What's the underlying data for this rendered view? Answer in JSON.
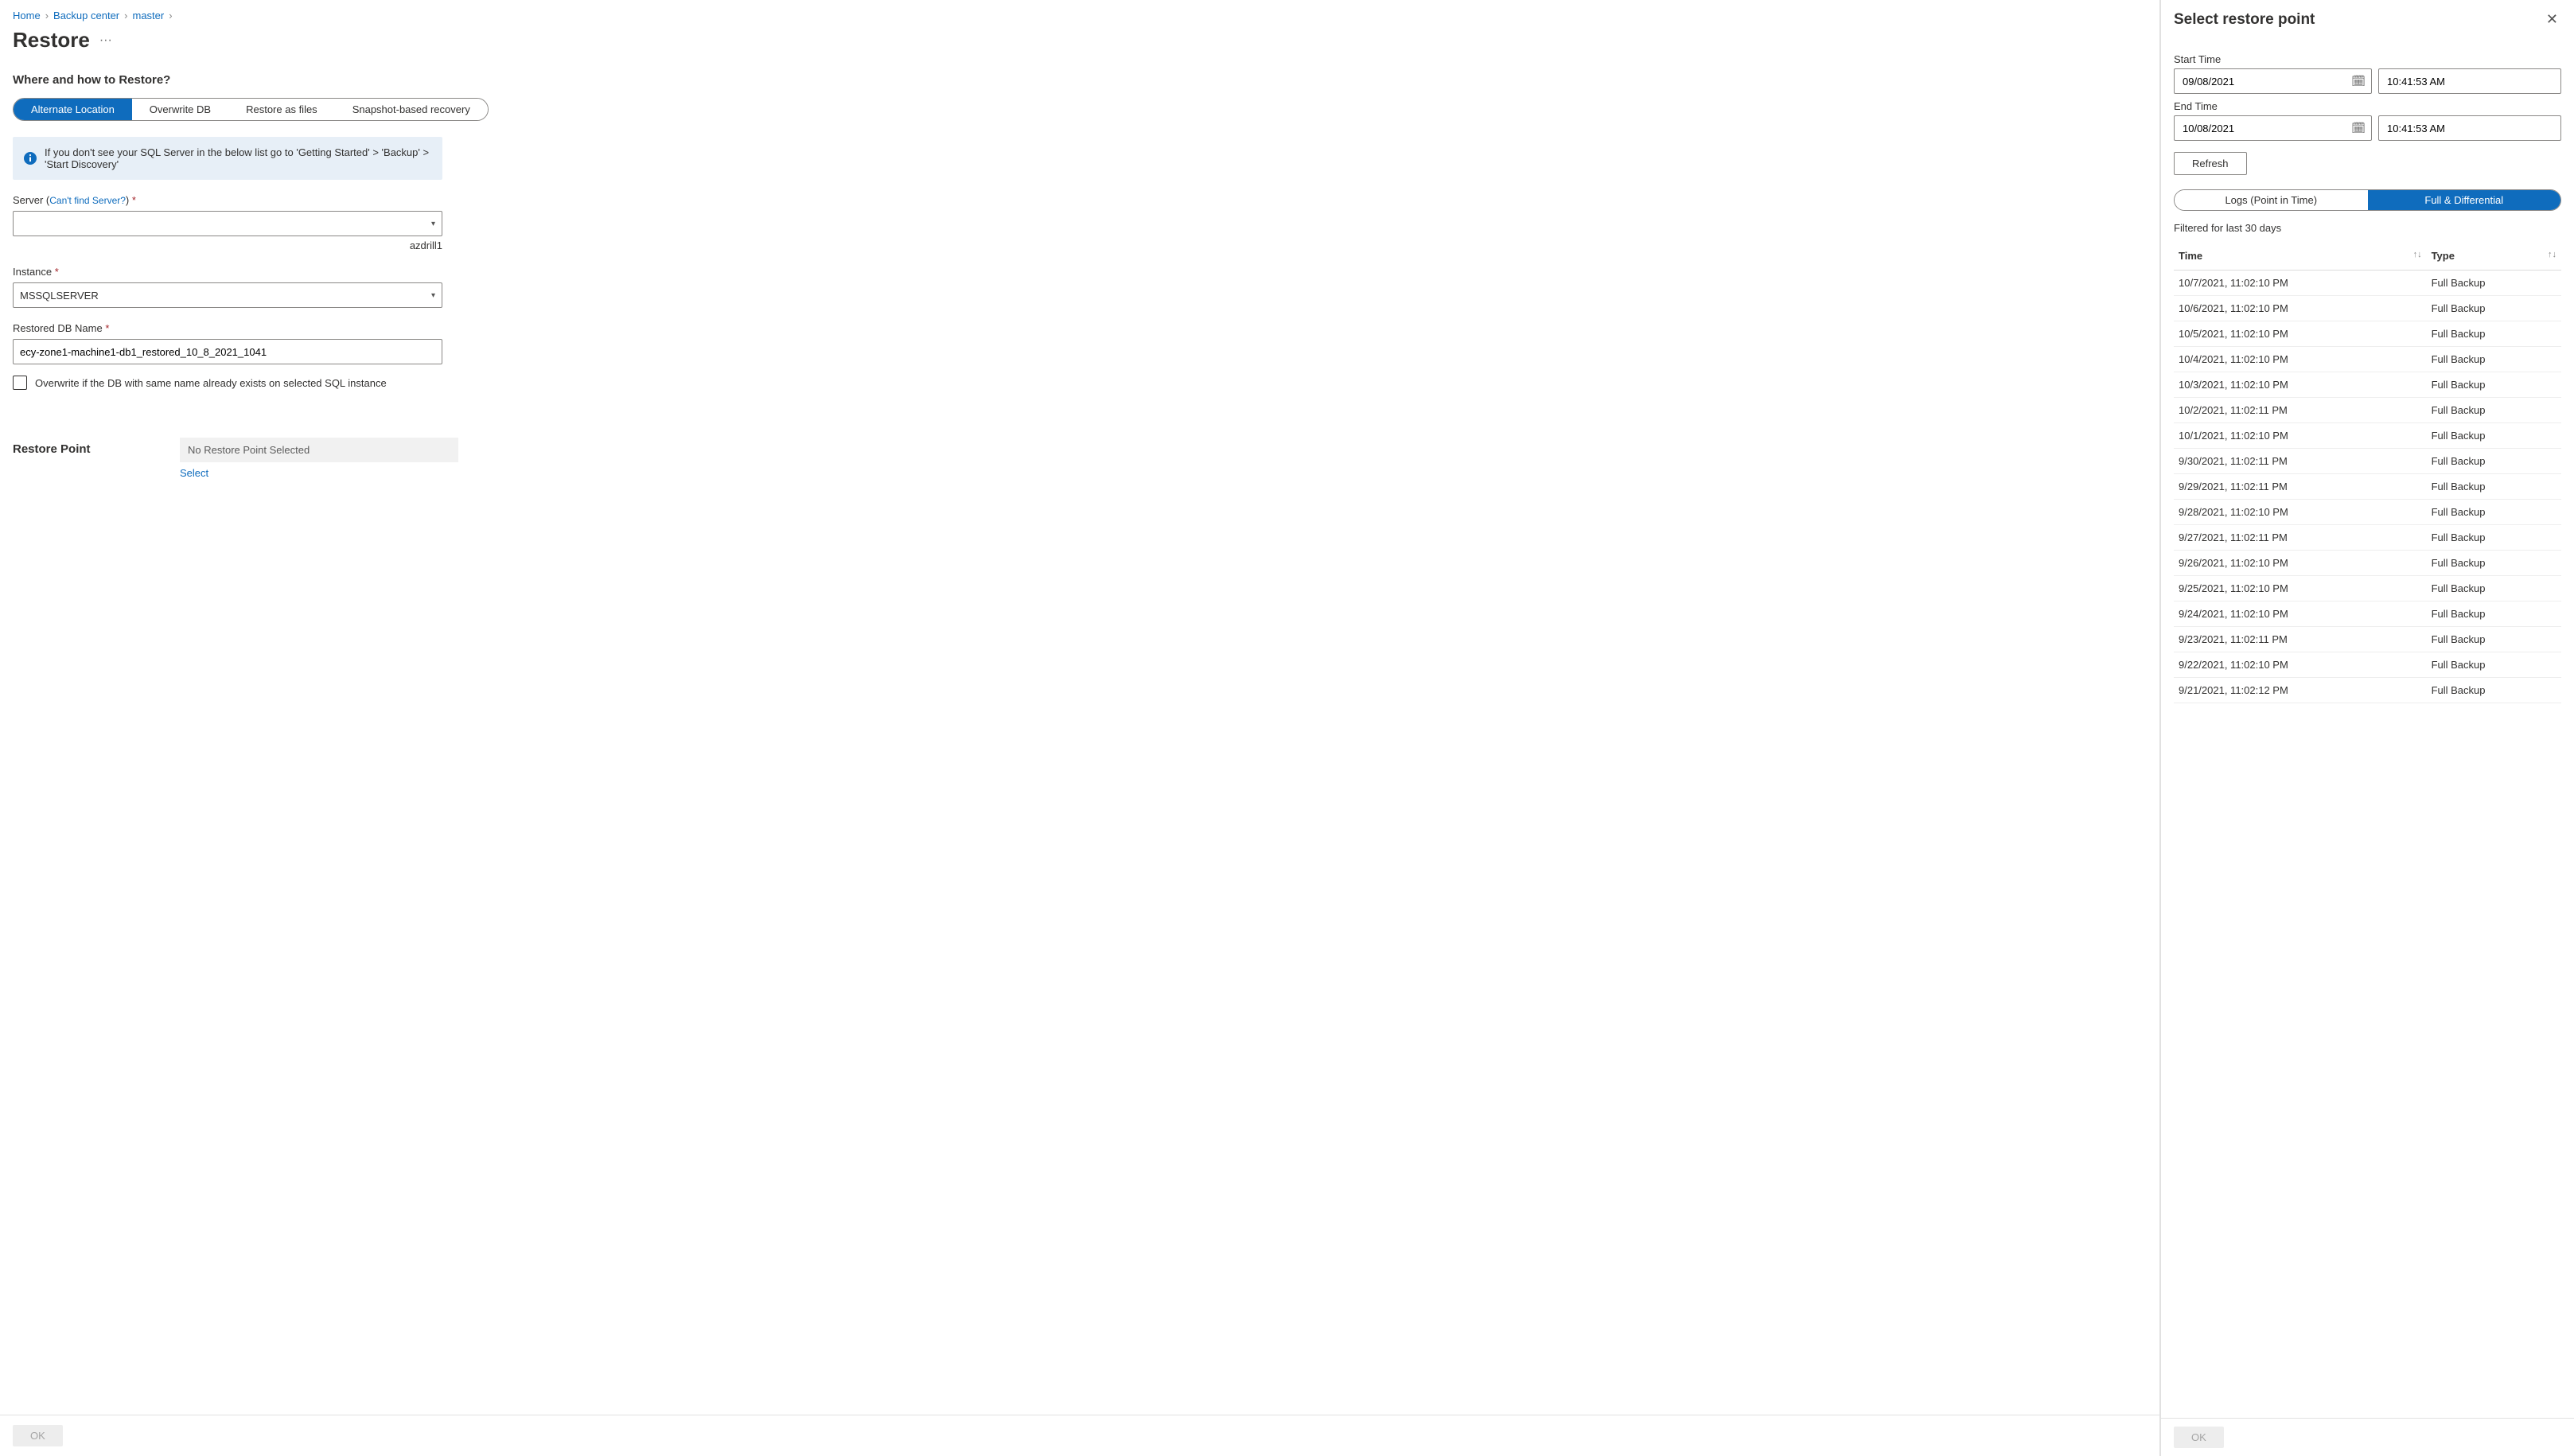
{
  "breadcrumb": {
    "home": "Home",
    "center": "Backup center",
    "master": "master"
  },
  "pageTitle": "Restore",
  "section1": "Where and how to Restore?",
  "tabs": {
    "alt": "Alternate Location",
    "overwrite": "Overwrite DB",
    "files": "Restore as files",
    "snapshot": "Snapshot-based recovery"
  },
  "infoMsg": "If you don't see your SQL Server in the below list go to 'Getting Started' > 'Backup' > 'Start Discovery'",
  "serverLabel": "Server (",
  "serverLink": "Can't find Server?",
  "serverLabel2": ")",
  "serverValue": "",
  "serverHelper": "azdrill1",
  "instanceLabel": "Instance",
  "instanceValue": "MSSQLSERVER",
  "dbNameLabel": "Restored DB Name",
  "dbNameValue": "ecy-zone1-machine1-db1_restored_10_8_2021_1041",
  "overwriteCb": "Overwrite if the DB with same name already exists on selected SQL instance",
  "restorePointLabel": "Restore Point",
  "noRestorePoint": "No Restore Point Selected",
  "selectLink": "Select",
  "okBtn": "OK",
  "panel": {
    "title": "Select restore point",
    "startTimeLabel": "Start Time",
    "startDate": "09/08/2021",
    "startTime": "10:41:53 AM",
    "endTimeLabel": "End Time",
    "endDate": "10/08/2021",
    "endTime": "10:41:53 AM",
    "refresh": "Refresh",
    "tabLogs": "Logs (Point in Time)",
    "tabFull": "Full & Differential",
    "filterNote": "Filtered for last 30 days",
    "colTime": "Time",
    "colType": "Type",
    "rows": [
      {
        "time": "10/7/2021, 11:02:10 PM",
        "type": "Full Backup"
      },
      {
        "time": "10/6/2021, 11:02:10 PM",
        "type": "Full Backup"
      },
      {
        "time": "10/5/2021, 11:02:10 PM",
        "type": "Full Backup"
      },
      {
        "time": "10/4/2021, 11:02:10 PM",
        "type": "Full Backup"
      },
      {
        "time": "10/3/2021, 11:02:10 PM",
        "type": "Full Backup"
      },
      {
        "time": "10/2/2021, 11:02:11 PM",
        "type": "Full Backup"
      },
      {
        "time": "10/1/2021, 11:02:10 PM",
        "type": "Full Backup"
      },
      {
        "time": "9/30/2021, 11:02:11 PM",
        "type": "Full Backup"
      },
      {
        "time": "9/29/2021, 11:02:11 PM",
        "type": "Full Backup"
      },
      {
        "time": "9/28/2021, 11:02:10 PM",
        "type": "Full Backup"
      },
      {
        "time": "9/27/2021, 11:02:11 PM",
        "type": "Full Backup"
      },
      {
        "time": "9/26/2021, 11:02:10 PM",
        "type": "Full Backup"
      },
      {
        "time": "9/25/2021, 11:02:10 PM",
        "type": "Full Backup"
      },
      {
        "time": "9/24/2021, 11:02:10 PM",
        "type": "Full Backup"
      },
      {
        "time": "9/23/2021, 11:02:11 PM",
        "type": "Full Backup"
      },
      {
        "time": "9/22/2021, 11:02:10 PM",
        "type": "Full Backup"
      },
      {
        "time": "9/21/2021, 11:02:12 PM",
        "type": "Full Backup"
      }
    ],
    "ok": "OK"
  }
}
